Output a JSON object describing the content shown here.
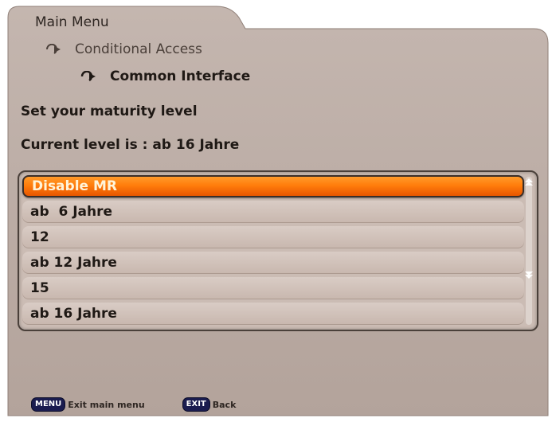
{
  "colors": {
    "panel": "#b9aaa3",
    "highlight": "#ff7d0c",
    "text": "#1f1915",
    "key_badge": "#1a1c4f"
  },
  "breadcrumb": {
    "level1": "Main Menu",
    "level2": "Conditional Access",
    "level3": "Common Interface",
    "icons": [
      "arrow-right-icon",
      "arrow-right-icon"
    ]
  },
  "prompt": "Set your maturity level",
  "current_level": "Current level is : ab 16 Jahre",
  "list": {
    "selected_index": 0,
    "items": [
      {
        "label": "Disable MR"
      },
      {
        "label": "ab  6 Jahre"
      },
      {
        "label": "12"
      },
      {
        "label": "ab 12 Jahre"
      },
      {
        "label": "15"
      },
      {
        "label": "ab 16 Jahre"
      }
    ],
    "scroll_up_icon": "scroll-up-icon",
    "scroll_down_icon": "scroll-down-icon"
  },
  "footer": {
    "menu_key": "MENU",
    "menu_label": "Exit main menu",
    "exit_key": "EXIT",
    "exit_label": "Back"
  }
}
